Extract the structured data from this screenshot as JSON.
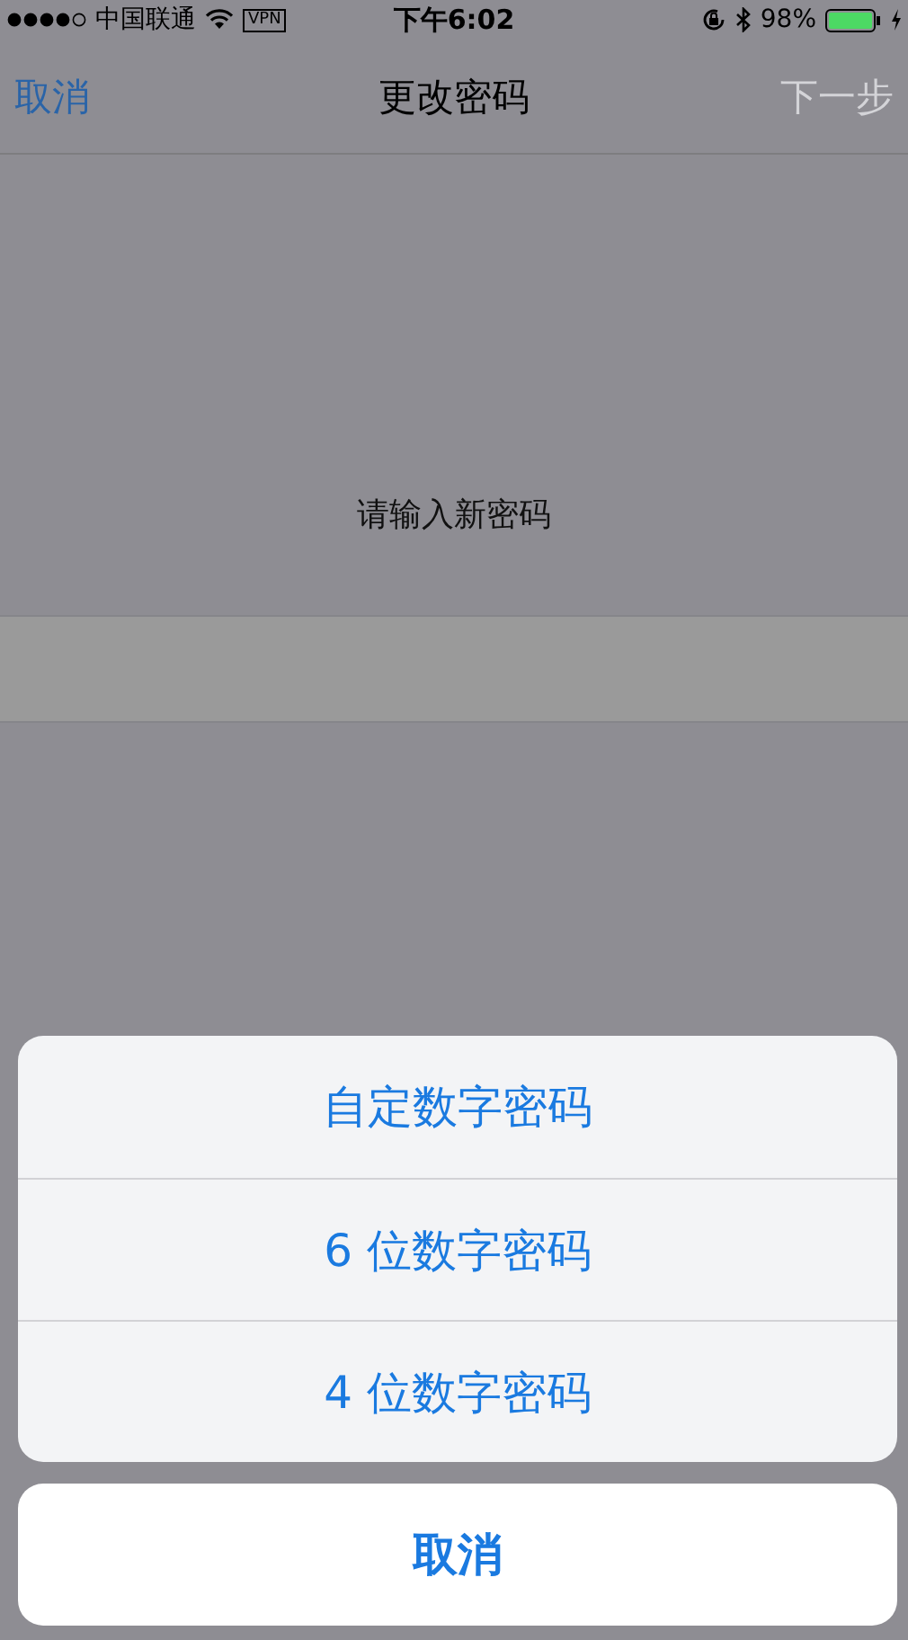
{
  "status_bar": {
    "carrier": "中国联通",
    "vpn": "VPN",
    "time": "下午6:02",
    "battery": "98%"
  },
  "nav_bar": {
    "left": "取消",
    "title": "更改密码",
    "right": {
      "label": "下一步",
      "disabled": true
    }
  },
  "prompt": "请输入新密码",
  "action_sheet": {
    "options": [
      {
        "label": "自定数字密码"
      },
      {
        "label": "6 位数字密码"
      },
      {
        "label": "4 位数字密码"
      }
    ],
    "cancel": "取消"
  }
}
